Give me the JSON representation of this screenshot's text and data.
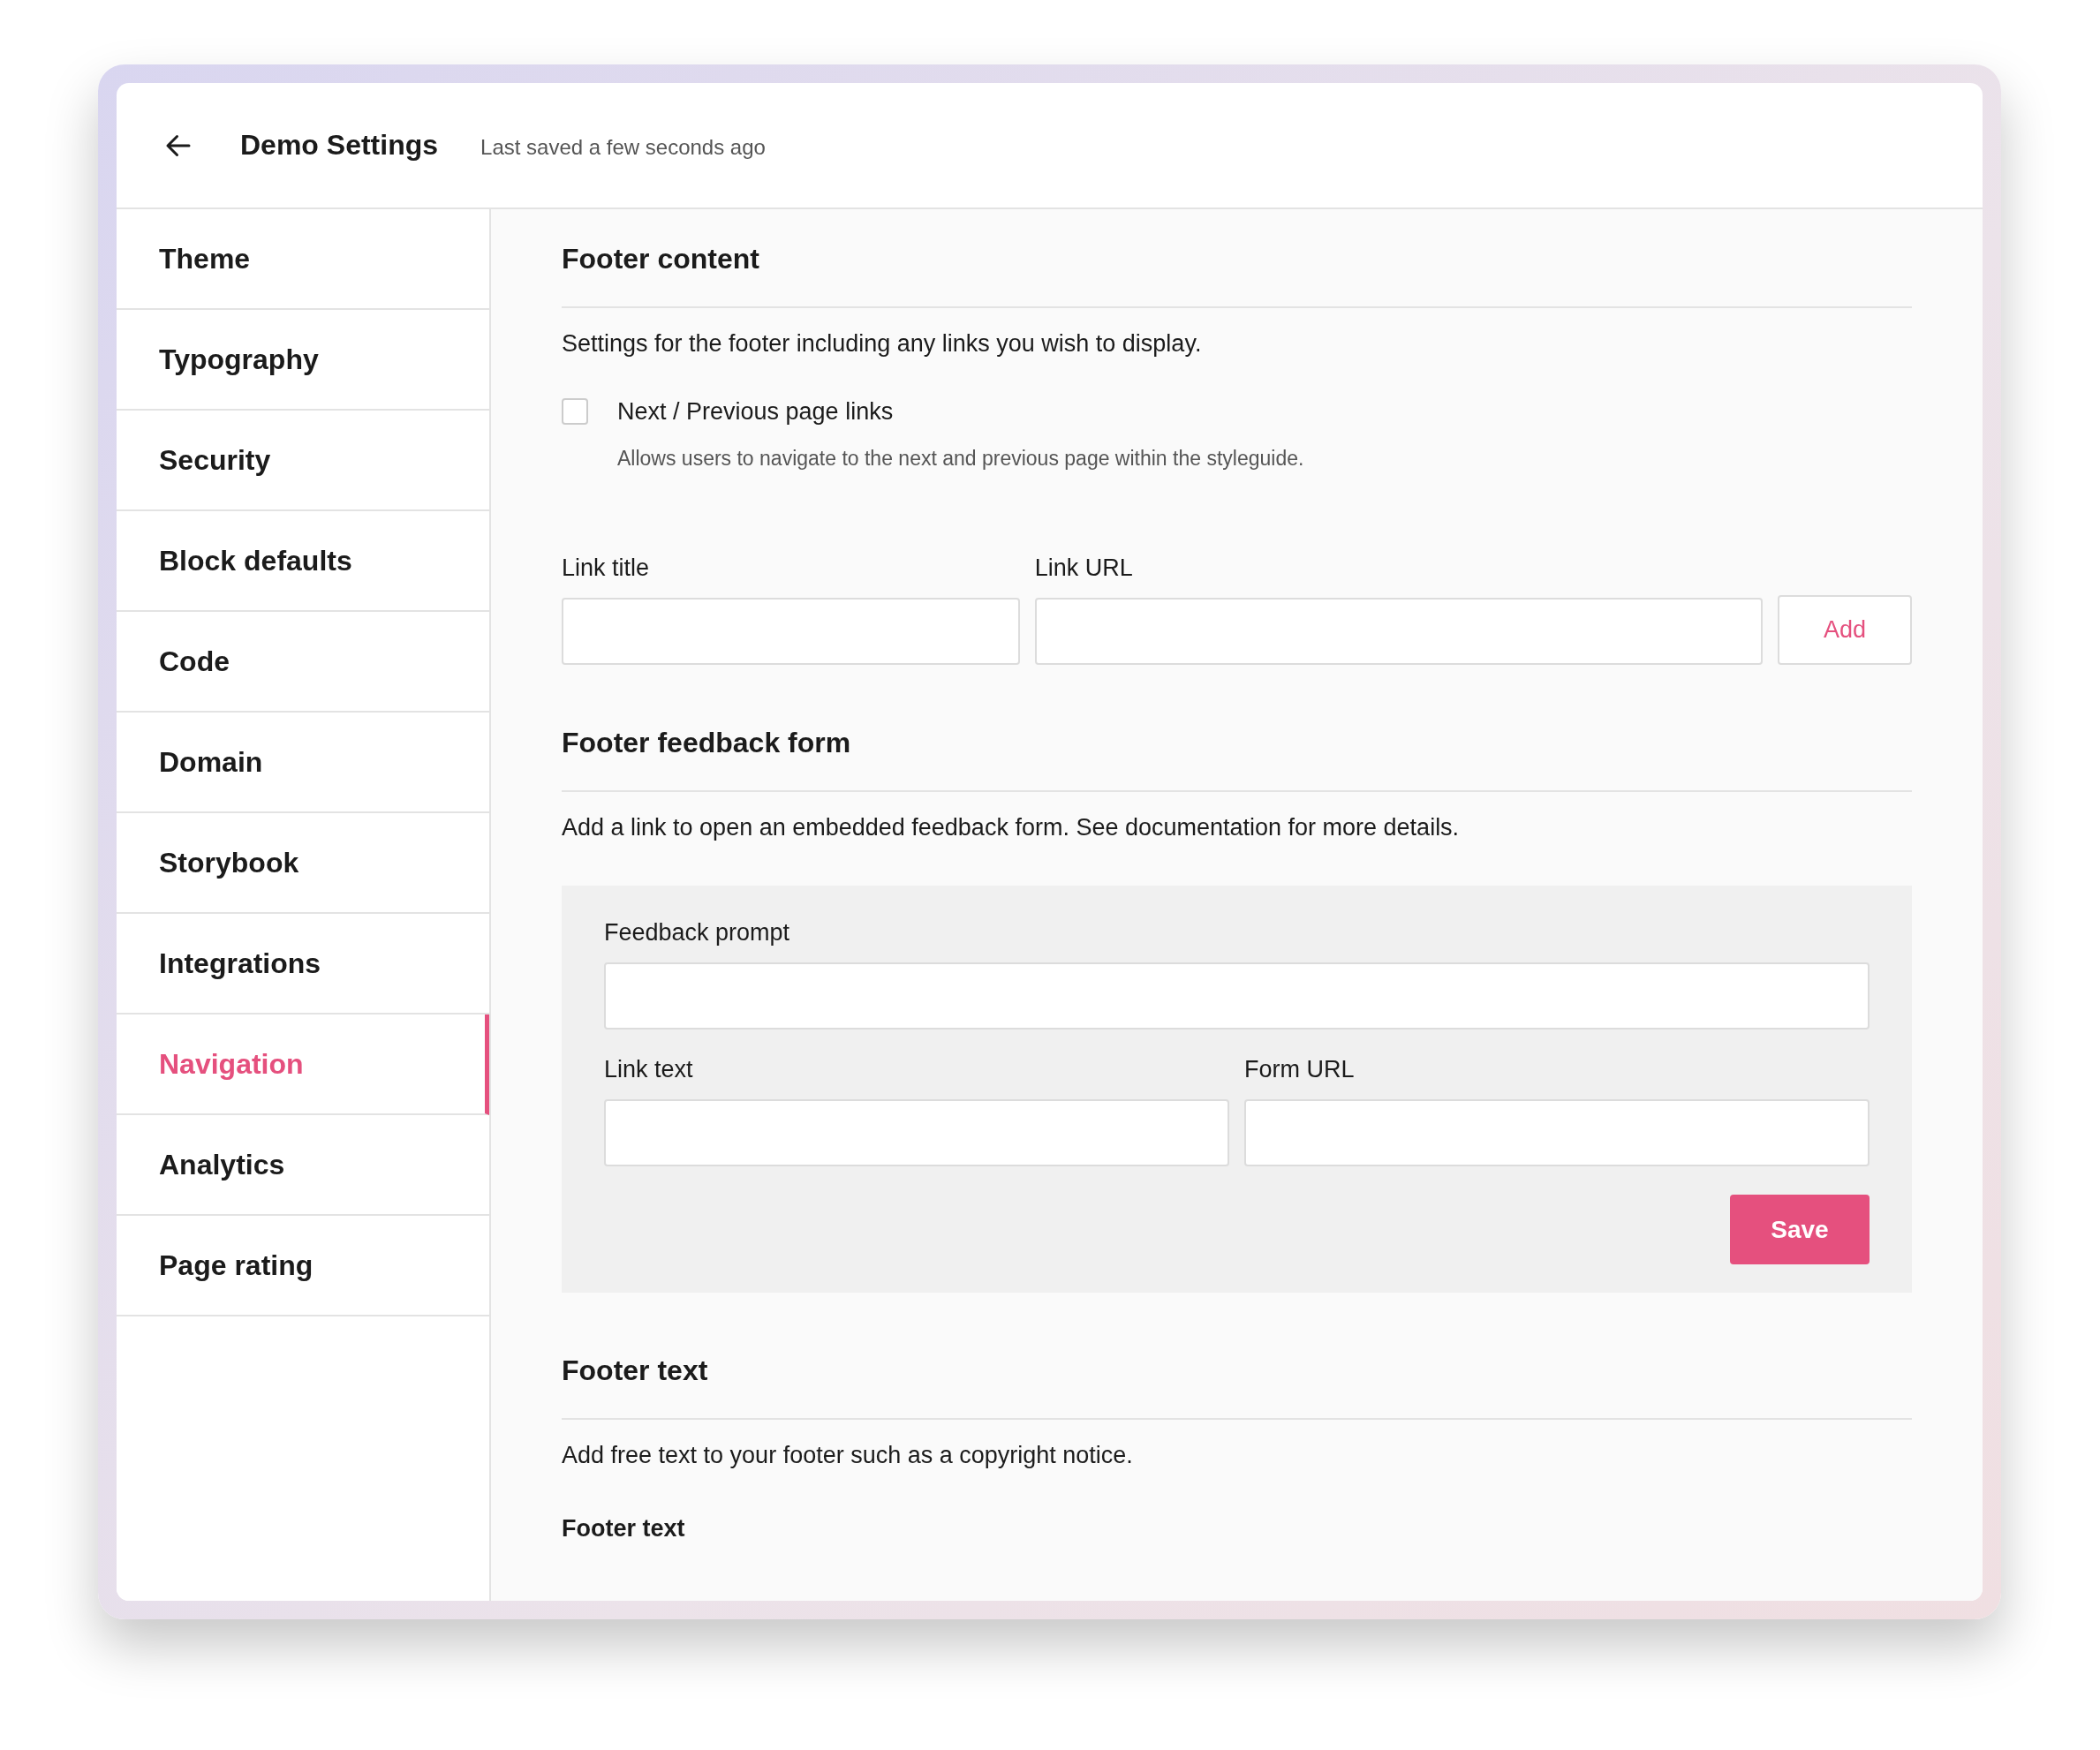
{
  "header": {
    "title": "Demo Settings",
    "status": "Last saved a few seconds ago"
  },
  "sidebar": {
    "items": [
      {
        "label": "Theme",
        "selected": false
      },
      {
        "label": "Typography",
        "selected": false
      },
      {
        "label": "Security",
        "selected": false
      },
      {
        "label": "Block defaults",
        "selected": false
      },
      {
        "label": "Code",
        "selected": false
      },
      {
        "label": "Domain",
        "selected": false
      },
      {
        "label": "Storybook",
        "selected": false
      },
      {
        "label": "Integrations",
        "selected": false
      },
      {
        "label": "Navigation",
        "selected": true
      },
      {
        "label": "Analytics",
        "selected": false
      },
      {
        "label": "Page rating",
        "selected": false
      }
    ]
  },
  "footer_content": {
    "heading": "Footer content",
    "description": "Settings for the footer including any links you wish to display.",
    "checkbox": {
      "label": "Next / Previous page links",
      "help": "Allows users to navigate to the next and previous page within the styleguide.",
      "checked": false
    },
    "link_fields": [
      {
        "label": "Link title"
      },
      {
        "label": "Link URL"
      }
    ],
    "add_button": "Add"
  },
  "footer_feedback_form": {
    "heading": "Footer feedback form",
    "description": "Add a link to open an embedded feedback form. See documentation for more details.",
    "fields": [
      {
        "label": "Feedback prompt"
      }
    ],
    "row_fields": [
      {
        "label": "Link text"
      },
      {
        "label": "Form URL"
      }
    ],
    "save_button": "Save"
  },
  "footer_text": {
    "heading": "Footer text",
    "description": "Add free text to your footer such as a copyright notice.",
    "field_label": "Footer text"
  }
}
